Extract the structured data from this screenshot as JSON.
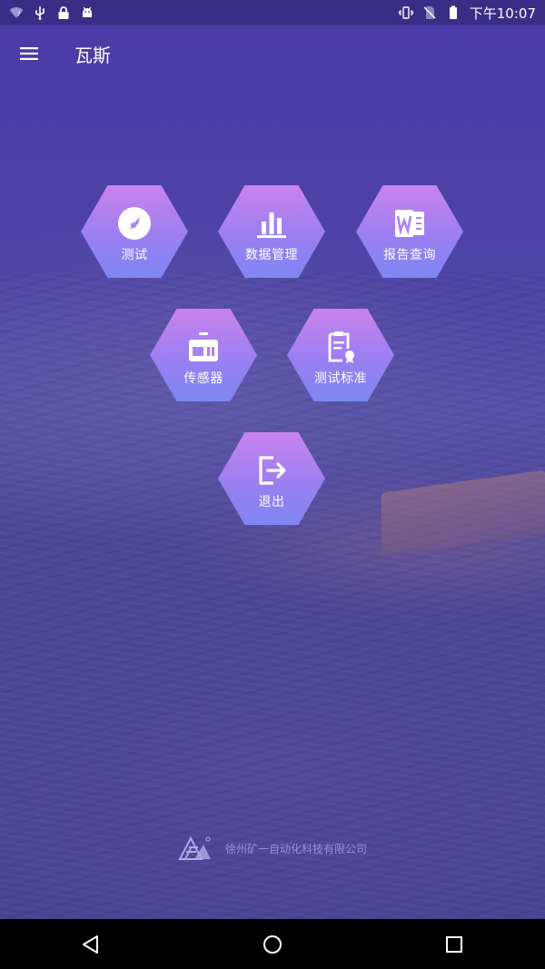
{
  "status_bar": {
    "left_icons": [
      "wifi-question-icon",
      "usb-icon",
      "lock-icon",
      "android-icon"
    ],
    "right_icons": [
      "vibrate-icon",
      "no-sim-icon",
      "battery-icon"
    ],
    "time": "下午10:07"
  },
  "app_bar": {
    "menu_icon": "menu-icon",
    "title": "瓦斯"
  },
  "menu_items": [
    {
      "label": "测试",
      "icon": "gauge-icon"
    },
    {
      "label": "数据管理",
      "icon": "bar-chart-icon"
    },
    {
      "label": "报告查询",
      "icon": "word-doc-icon"
    },
    {
      "label": "传感器",
      "icon": "radio-icon"
    },
    {
      "label": "测试标准",
      "icon": "certificate-icon"
    },
    {
      "label": "退出",
      "icon": "logout-icon"
    }
  ],
  "footer": {
    "company": "徐州矿一自动化科技有限公司",
    "logo_icon": "company-logo"
  },
  "nav_bar": {
    "buttons": [
      "back-icon",
      "home-icon",
      "recents-icon"
    ]
  },
  "colors": {
    "hex_top": "#c983ee",
    "hex_bottom": "#7e86f2",
    "status_bar": "#3a2d86",
    "background": "#4a3f99"
  }
}
